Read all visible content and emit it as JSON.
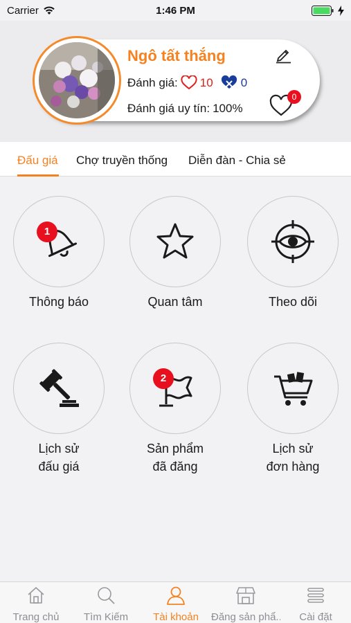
{
  "status_bar": {
    "carrier": "Carrier",
    "time": "1:46 PM"
  },
  "profile": {
    "name": "Ngô tất thắng",
    "rating_label": "Đánh giá:",
    "rating_good": "10",
    "rating_bad": "0",
    "trust_label": "Đánh giá uy tín:",
    "trust_value": "100%",
    "favorites_count": "0"
  },
  "tabs": [
    {
      "label": "Đấu giá",
      "active": true
    },
    {
      "label": "Chợ truyền thống",
      "active": false
    },
    {
      "label": "Diễn đàn - Chia sẻ",
      "active": false
    }
  ],
  "grid": {
    "notifications": {
      "label": "Thông báo",
      "badge": "1",
      "icon": "bell-icon"
    },
    "interests": {
      "label": "Quan tâm",
      "icon": "star-icon"
    },
    "following": {
      "label": "Theo dõi",
      "icon": "eye-target-icon"
    },
    "auction_history": {
      "line1": "Lịch sử",
      "line2": "đấu giá",
      "icon": "gavel-icon"
    },
    "posted_products": {
      "line1": "Sản phẩm",
      "line2": "đã đăng",
      "badge": "2",
      "icon": "flag-icon"
    },
    "order_history": {
      "line1": "Lịch sử",
      "line2": "đơn hàng",
      "icon": "cart-icon"
    }
  },
  "tabbar": [
    {
      "label": "Trang chủ",
      "icon": "home-icon"
    },
    {
      "label": "Tìm Kiếm",
      "icon": "search-icon"
    },
    {
      "label": "Tài khoản",
      "icon": "user-icon",
      "active": true
    },
    {
      "label": "Đăng sản phẩ...",
      "icon": "store-icon"
    },
    {
      "label": "Cài đặt",
      "icon": "menu-icon"
    }
  ],
  "colors": {
    "accent": "#f58220",
    "badge": "#e8101e",
    "rating_good": "#e0201b",
    "rating_bad": "#1a3c9a"
  }
}
